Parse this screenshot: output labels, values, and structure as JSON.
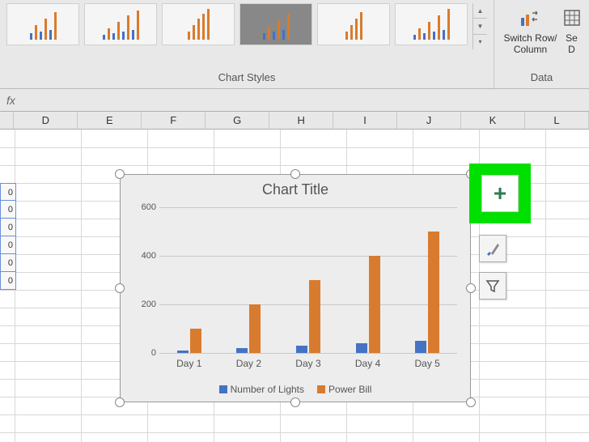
{
  "ribbon": {
    "chart_styles_label": "Chart Styles",
    "data_group_label": "Data",
    "switch_row_col": "Switch Row/\nColumn",
    "select_data": "Se\nD"
  },
  "formula_bar": {
    "fx": "fx"
  },
  "columns": [
    "D",
    "E",
    "F",
    "G",
    "H",
    "I",
    "J",
    "K",
    "L"
  ],
  "data_cells": [
    "0",
    "0",
    "0",
    "0",
    "0",
    "0"
  ],
  "chart_data": {
    "type": "bar",
    "title": "Chart Title",
    "categories": [
      "Day 1",
      "Day 2",
      "Day 3",
      "Day 4",
      "Day 5"
    ],
    "series": [
      {
        "name": "Number of Lights",
        "values": [
          10,
          20,
          30,
          40,
          50
        ],
        "color": "#4472c4"
      },
      {
        "name": "Power Bill",
        "values": [
          100,
          200,
          300,
          400,
          500
        ],
        "color": "#d97b2e"
      }
    ],
    "ylim": [
      0,
      600
    ],
    "yticks": [
      0,
      200,
      400,
      600
    ],
    "xlabel": "",
    "ylabel": ""
  },
  "side_tools": {
    "chart_elements": "+",
    "chart_styles": "brush",
    "chart_filters": "filter"
  }
}
